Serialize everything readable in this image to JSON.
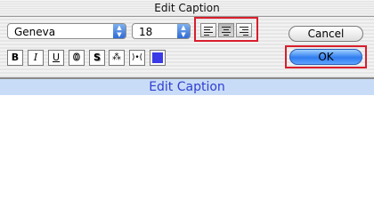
{
  "window": {
    "title": "Edit Caption"
  },
  "toolbar": {
    "font_select": {
      "value": "Geneva"
    },
    "size_select": {
      "value": "18"
    },
    "alignment": {
      "left_label": "Align left",
      "center_label": "Align center",
      "right_label": "Align right",
      "selected": "center"
    },
    "style_buttons": [
      {
        "name": "bold",
        "glyph": "B"
      },
      {
        "name": "italic",
        "glyph": "I"
      },
      {
        "name": "underline",
        "glyph": "U"
      },
      {
        "name": "outline",
        "glyph": "0"
      },
      {
        "name": "shadow",
        "glyph": "S"
      },
      {
        "name": "condense",
        "glyph": "⁂"
      },
      {
        "name": "extend",
        "glyph": ")•("
      }
    ],
    "text_color": "#3a3ae6",
    "cancel_label": "Cancel",
    "ok_label": "OK"
  },
  "content": {
    "caption_text": "Edit Caption"
  },
  "colors": {
    "highlight_red": "#d81e2c",
    "caption_bar": "#c9dcf7",
    "caption_text": "#2f3fd0",
    "ok_blue": "#2f7cf0"
  }
}
